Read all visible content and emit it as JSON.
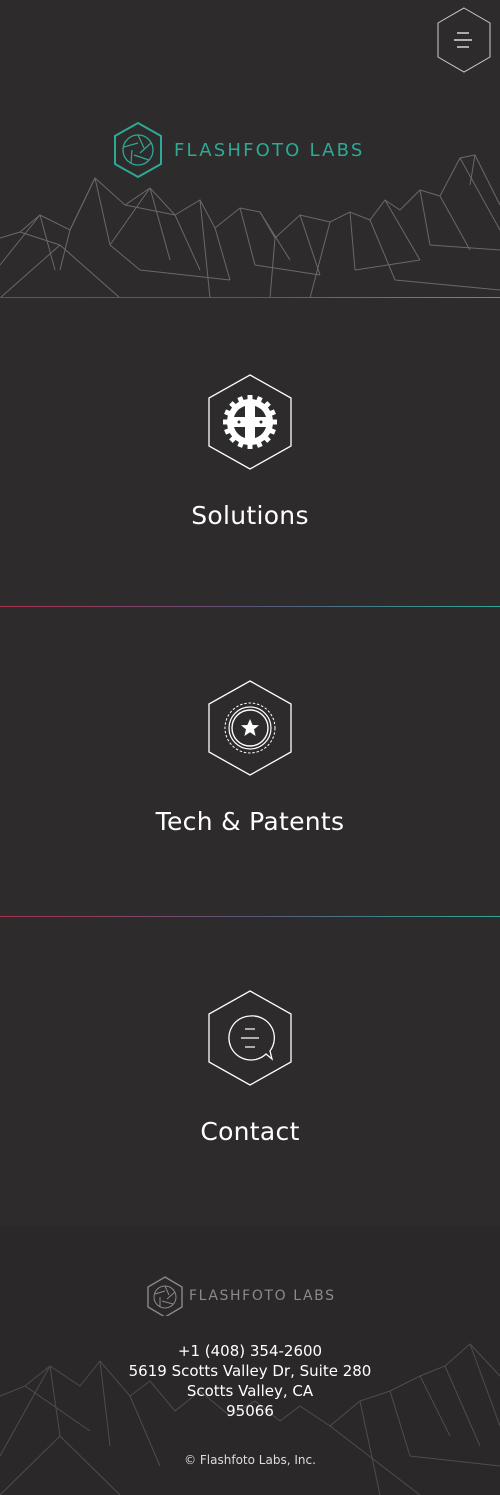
{
  "header": {
    "brand": "FLASHFOTO LABS",
    "brand_color": "#2fa896"
  },
  "nav": {
    "menu_icon": "hamburger-menu-icon"
  },
  "sections": [
    {
      "label": "Solutions",
      "icon": "gear-wheel-icon"
    },
    {
      "label": "Tech & Patents",
      "icon": "star-badge-icon"
    },
    {
      "label": "Contact",
      "icon": "chat-bubble-icon"
    }
  ],
  "footer": {
    "brand": "FLASHFOTO LABS",
    "phone": "+1 (408) 354-2600",
    "address_line1": "5619 Scotts Valley Dr, Suite 280",
    "address_line2": "Scotts Valley, CA",
    "zip": "95066",
    "copyright": "© Flashfoto Labs, Inc."
  },
  "colors": {
    "background": "#2d2b2b",
    "footer_background": "#2a2828",
    "divider_start": "#c23a5a",
    "divider_end": "#2fa896"
  }
}
